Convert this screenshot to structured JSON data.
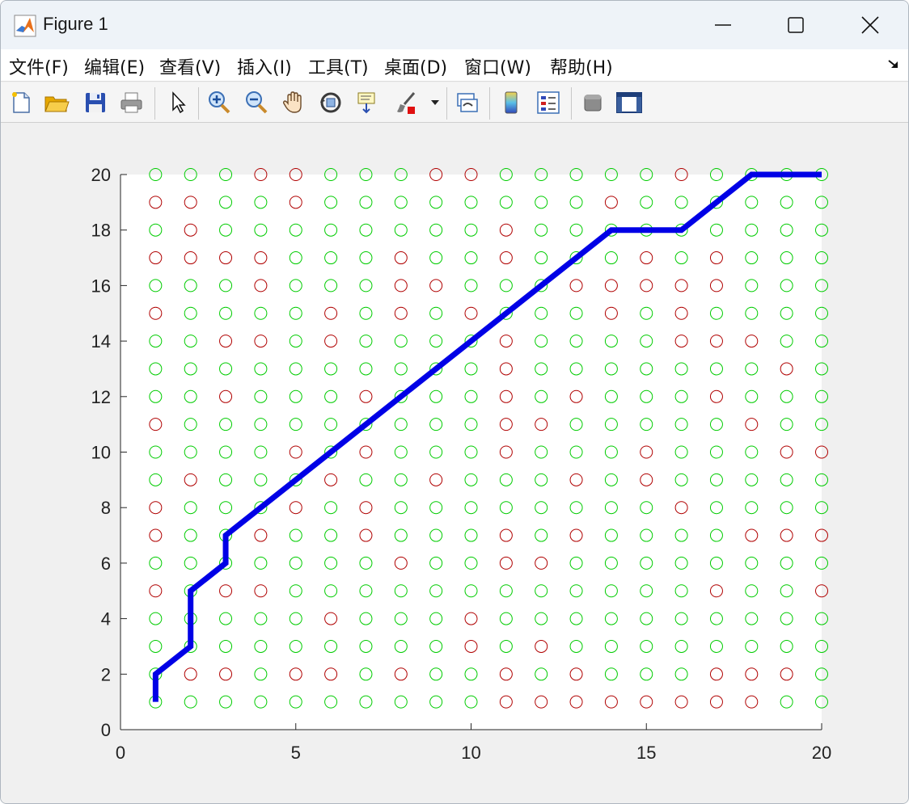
{
  "window": {
    "title": "Figure 1"
  },
  "menu": {
    "items": [
      "文件(F)",
      "编辑(E)",
      "查看(V)",
      "插入(I)",
      "工具(T)",
      "桌面(D)",
      "窗口(W)",
      "帮助(H)"
    ]
  },
  "toolbar": {
    "buttons": [
      "new-figure-icon",
      "open-file-icon",
      "save-icon",
      "print-icon",
      "pointer-icon",
      "zoom-in-icon",
      "zoom-out-icon",
      "pan-hand-icon",
      "rotate-3d-icon",
      "data-cursor-icon",
      "brush-icon",
      "brush-dropdown-icon",
      "link-plot-icon",
      "colorbar-icon",
      "legend-icon",
      "hide-plot-tools-icon",
      "show-plot-tools-icon"
    ]
  },
  "colors": {
    "path": "#0000e6",
    "free_node": "#00cc00",
    "obstacle_node": "#b00000",
    "axes_bg": "#ffffff",
    "figure_bg": "#f0f0f0"
  },
  "chart_data": {
    "type": "scatter",
    "xlim": [
      0,
      20
    ],
    "ylim": [
      0,
      20
    ],
    "xticks": [
      0,
      5,
      10,
      15,
      20
    ],
    "yticks": [
      0,
      2,
      4,
      6,
      8,
      10,
      12,
      14,
      16,
      18,
      20
    ],
    "grid": false,
    "title": "",
    "xlabel": "",
    "ylabel": "",
    "obstacles": [
      [
        4,
        20
      ],
      [
        5,
        20
      ],
      [
        9,
        20
      ],
      [
        10,
        20
      ],
      [
        16,
        20
      ],
      [
        1,
        19
      ],
      [
        2,
        19
      ],
      [
        5,
        19
      ],
      [
        14,
        19
      ],
      [
        2,
        18
      ],
      [
        11,
        18
      ],
      [
        1,
        17
      ],
      [
        2,
        17
      ],
      [
        3,
        17
      ],
      [
        4,
        17
      ],
      [
        8,
        17
      ],
      [
        11,
        17
      ],
      [
        15,
        17
      ],
      [
        17,
        17
      ],
      [
        4,
        16
      ],
      [
        8,
        16
      ],
      [
        9,
        16
      ],
      [
        13,
        16
      ],
      [
        14,
        16
      ],
      [
        15,
        16
      ],
      [
        16,
        16
      ],
      [
        17,
        16
      ],
      [
        1,
        15
      ],
      [
        6,
        15
      ],
      [
        8,
        15
      ],
      [
        10,
        15
      ],
      [
        14,
        15
      ],
      [
        16,
        15
      ],
      [
        3,
        14
      ],
      [
        4,
        14
      ],
      [
        6,
        14
      ],
      [
        11,
        14
      ],
      [
        16,
        14
      ],
      [
        17,
        14
      ],
      [
        18,
        14
      ],
      [
        11,
        13
      ],
      [
        19,
        13
      ],
      [
        3,
        12
      ],
      [
        7,
        12
      ],
      [
        11,
        12
      ],
      [
        13,
        12
      ],
      [
        17,
        12
      ],
      [
        1,
        11
      ],
      [
        11,
        11
      ],
      [
        12,
        11
      ],
      [
        18,
        11
      ],
      [
        5,
        10
      ],
      [
        7,
        10
      ],
      [
        11,
        10
      ],
      [
        15,
        10
      ],
      [
        19,
        10
      ],
      [
        20,
        10
      ],
      [
        2,
        9
      ],
      [
        6,
        9
      ],
      [
        9,
        9
      ],
      [
        13,
        9
      ],
      [
        15,
        9
      ],
      [
        1,
        8
      ],
      [
        5,
        8
      ],
      [
        7,
        8
      ],
      [
        16,
        8
      ],
      [
        1,
        7
      ],
      [
        4,
        7
      ],
      [
        7,
        7
      ],
      [
        11,
        7
      ],
      [
        13,
        7
      ],
      [
        18,
        7
      ],
      [
        19,
        7
      ],
      [
        20,
        7
      ],
      [
        8,
        6
      ],
      [
        11,
        6
      ],
      [
        12,
        6
      ],
      [
        1,
        5
      ],
      [
        3,
        5
      ],
      [
        4,
        5
      ],
      [
        17,
        5
      ],
      [
        20,
        5
      ],
      [
        6,
        4
      ],
      [
        10,
        4
      ],
      [
        10,
        3
      ],
      [
        12,
        3
      ],
      [
        2,
        2
      ],
      [
        3,
        2
      ],
      [
        5,
        2
      ],
      [
        6,
        2
      ],
      [
        8,
        2
      ],
      [
        11,
        2
      ],
      [
        13,
        2
      ],
      [
        17,
        2
      ],
      [
        18,
        2
      ],
      [
        19,
        2
      ],
      [
        11,
        1
      ],
      [
        12,
        1
      ],
      [
        13,
        1
      ],
      [
        14,
        1
      ],
      [
        15,
        1
      ],
      [
        16,
        1
      ],
      [
        17,
        1
      ],
      [
        18,
        1
      ]
    ],
    "path": {
      "x": [
        1,
        1,
        2,
        2,
        3,
        3,
        14,
        16,
        18,
        20
      ],
      "y": [
        1,
        2,
        3,
        5,
        6,
        7,
        18,
        18,
        20,
        20
      ]
    }
  }
}
